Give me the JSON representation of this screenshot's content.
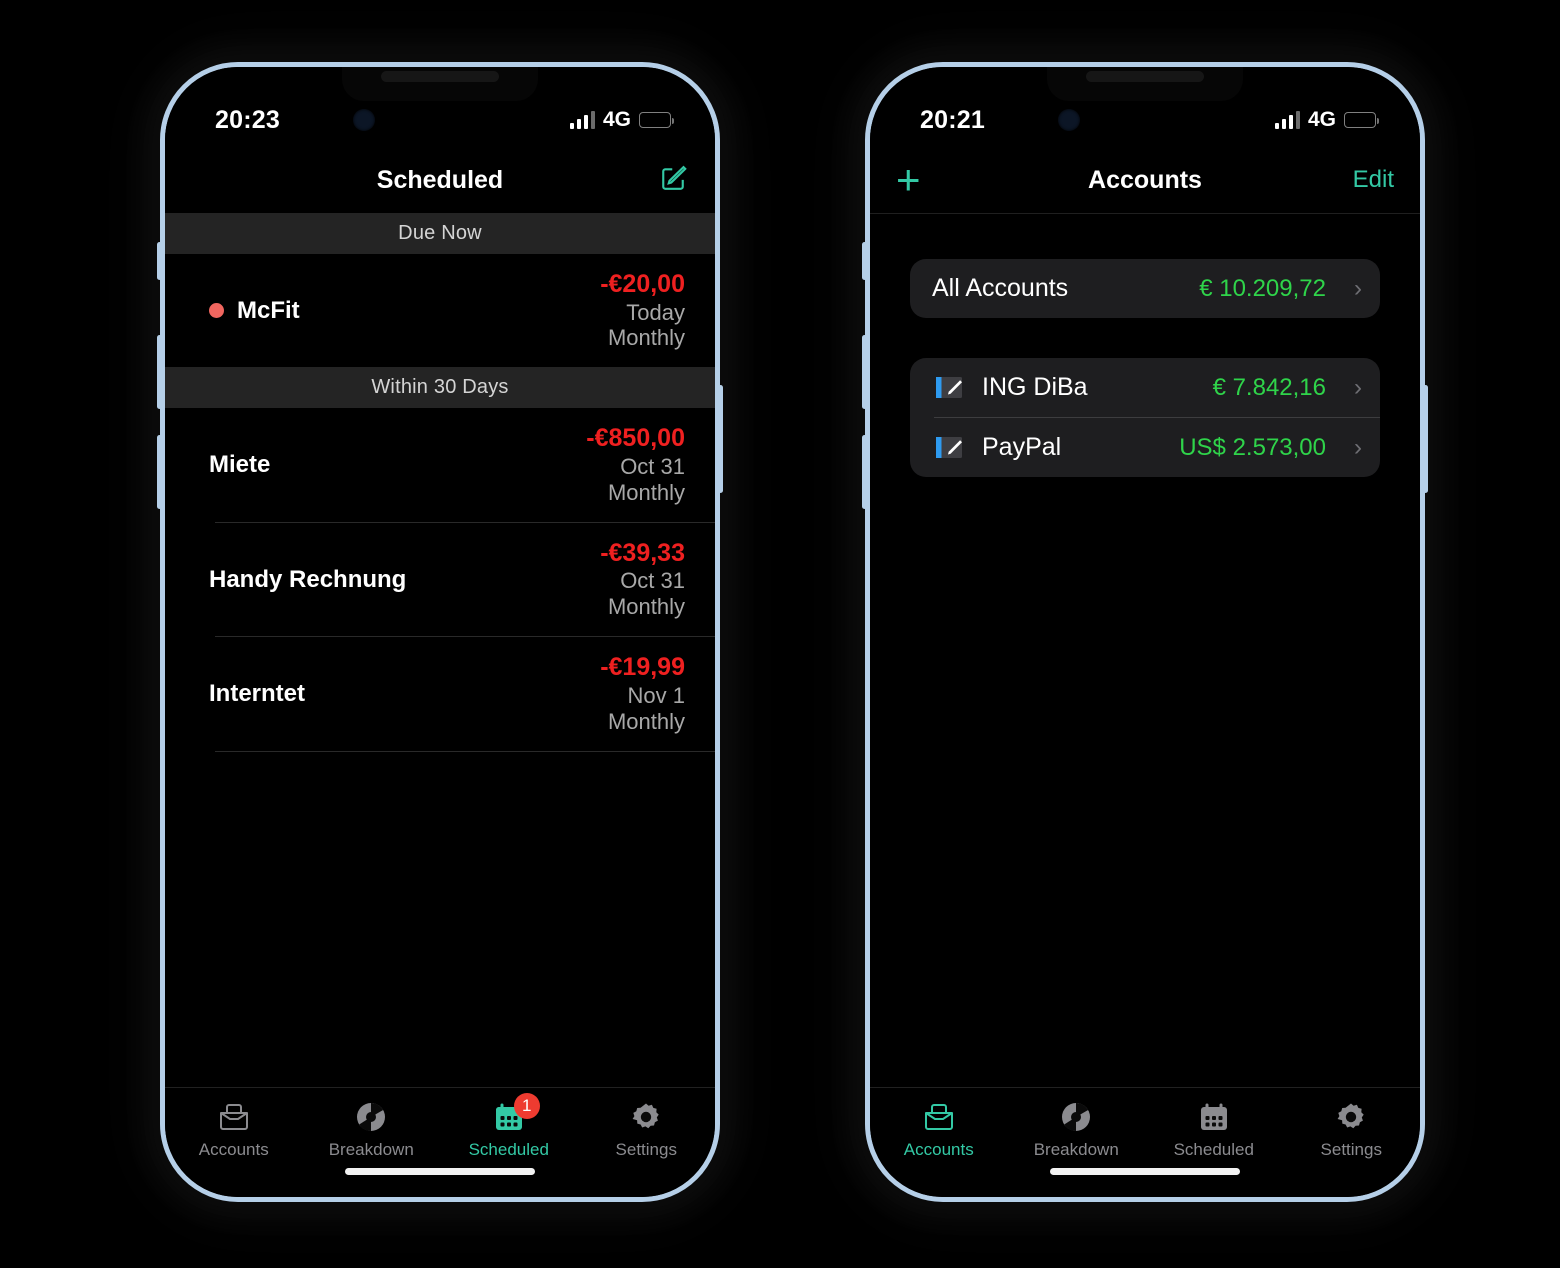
{
  "colors": {
    "accent": "#33c9a5",
    "negative": "#ef2020",
    "positive": "#2fd44a",
    "badge": "#ee3b30",
    "dot": "#f0665f",
    "frame": "#b5cfe8",
    "card": "#1e1e20",
    "section_header": "#242424",
    "battery": "#f5c518"
  },
  "phone_left": {
    "status": {
      "time": "20:23",
      "network": "4G",
      "signal_bars": 3,
      "battery_percent": 18
    },
    "nav": {
      "title": "Scheduled",
      "right_icon": "compose-icon"
    },
    "sections": [
      {
        "header": "Due Now",
        "rows": [
          {
            "name": "McFit",
            "has_dot": true,
            "amount": "-€20,00",
            "date": "Today",
            "frequency": "Monthly"
          }
        ]
      },
      {
        "header": "Within 30 Days",
        "rows": [
          {
            "name": "Miete",
            "has_dot": false,
            "amount": "-€850,00",
            "date": "Oct 31",
            "frequency": "Monthly"
          },
          {
            "name": "Handy Rechnung",
            "has_dot": false,
            "amount": "-€39,33",
            "date": "Oct 31",
            "frequency": "Monthly"
          },
          {
            "name": "Interntet",
            "has_dot": false,
            "amount": "-€19,99",
            "date": "Nov 1",
            "frequency": "Monthly"
          }
        ]
      }
    ],
    "tabs": [
      {
        "label": "Accounts",
        "icon": "wallet-icon",
        "active": false,
        "badge": null
      },
      {
        "label": "Breakdown",
        "icon": "pie-chart-icon",
        "active": false,
        "badge": null
      },
      {
        "label": "Scheduled",
        "icon": "calendar-icon",
        "active": true,
        "badge": "1"
      },
      {
        "label": "Settings",
        "icon": "gear-icon",
        "active": false,
        "badge": null
      }
    ]
  },
  "phone_right": {
    "status": {
      "time": "20:21",
      "network": "4G",
      "signal_bars": 3,
      "battery_percent": 18
    },
    "nav": {
      "title": "Accounts",
      "left_icon": "plus-icon",
      "left_label": "+",
      "right_label": "Edit"
    },
    "summary_card": {
      "label": "All Accounts",
      "amount": "€ 10.209,72",
      "chevron": "›"
    },
    "accounts": [
      {
        "name": "ING DiBa",
        "amount": "€ 7.842,16",
        "icon": "account-edit-icon",
        "chevron": "›"
      },
      {
        "name": "PayPal",
        "amount": "US$ 2.573,00",
        "icon": "account-edit-icon",
        "chevron": "›"
      }
    ],
    "tabs": [
      {
        "label": "Accounts",
        "icon": "wallet-icon",
        "active": true,
        "badge": null
      },
      {
        "label": "Breakdown",
        "icon": "pie-chart-icon",
        "active": false,
        "badge": null
      },
      {
        "label": "Scheduled",
        "icon": "calendar-icon",
        "active": false,
        "badge": null
      },
      {
        "label": "Settings",
        "icon": "gear-icon",
        "active": false,
        "badge": null
      }
    ]
  }
}
